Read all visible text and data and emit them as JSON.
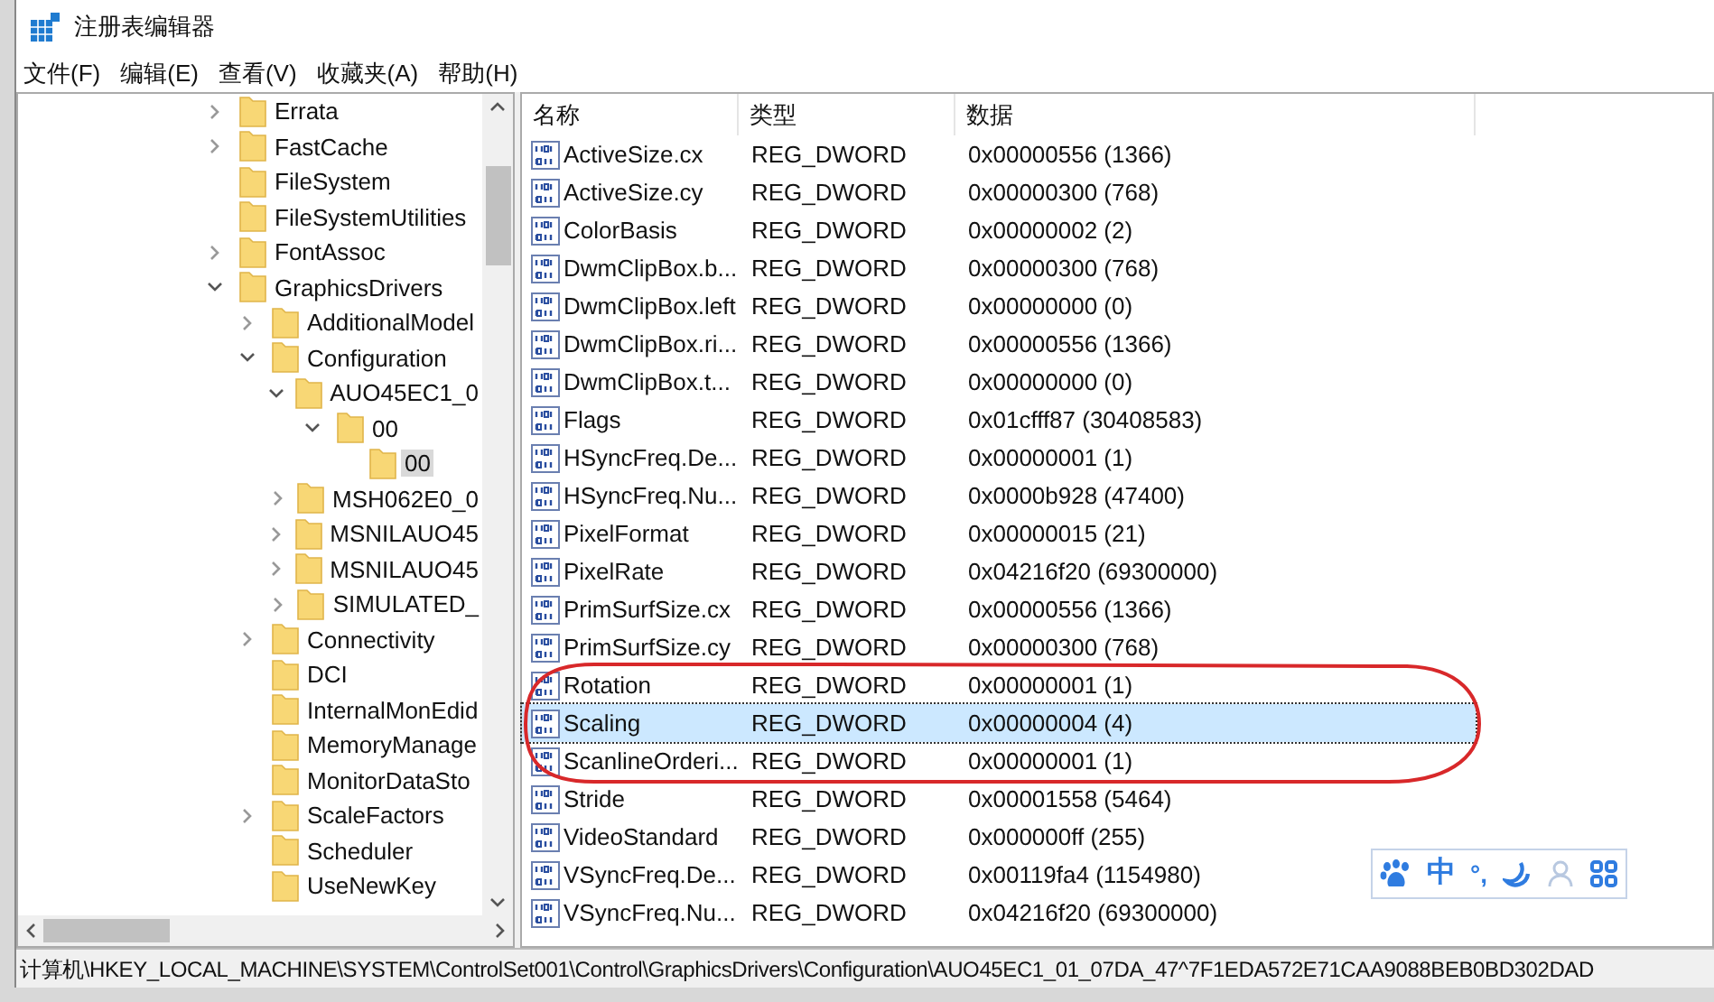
{
  "window": {
    "title": "注册表编辑器"
  },
  "menu": [
    "文件(F)",
    "编辑(E)",
    "查看(V)",
    "收藏夹(A)",
    "帮助(H)"
  ],
  "tree": [
    {
      "label": "Errata",
      "expanded": false,
      "selected": false
    },
    {
      "label": "FastCache",
      "expanded": false,
      "selected": false
    },
    {
      "label": "FileSystem",
      "selected": false
    },
    {
      "label": "FileSystemUtilities",
      "selected": false
    },
    {
      "label": "FontAssoc",
      "expanded": false,
      "selected": false
    },
    {
      "label": "GraphicsDrivers",
      "expanded": true,
      "selected": false,
      "children": [
        {
          "label": "AdditionalModel",
          "expanded": false,
          "selected": false
        },
        {
          "label": "Configuration",
          "expanded": true,
          "selected": false,
          "children": [
            {
              "label": "AUO45EC1_0",
              "expanded": true,
              "selected": false,
              "children": [
                {
                  "label": "00",
                  "expanded": true,
                  "selected": false,
                  "children": [
                    {
                      "label": "00",
                      "selected": true
                    }
                  ]
                }
              ]
            },
            {
              "label": "MSH062E0_0",
              "expanded": false,
              "selected": false
            },
            {
              "label": "MSNILAUO45",
              "expanded": false,
              "selected": false
            },
            {
              "label": "MSNILAUO45",
              "expanded": false,
              "selected": false
            },
            {
              "label": "SIMULATED_",
              "expanded": false,
              "selected": false
            }
          ]
        },
        {
          "label": "Connectivity",
          "expanded": false,
          "selected": false
        },
        {
          "label": "DCI",
          "selected": false
        },
        {
          "label": "InternalMonEdid",
          "selected": false
        },
        {
          "label": "MemoryManage",
          "selected": false
        },
        {
          "label": "MonitorDataSto",
          "selected": false
        },
        {
          "label": "ScaleFactors",
          "expanded": false,
          "selected": false
        },
        {
          "label": "Scheduler",
          "selected": false
        },
        {
          "label": "UseNewKey",
          "selected": false
        }
      ]
    }
  ],
  "table": {
    "columns": [
      "名称",
      "类型",
      "数据"
    ],
    "rows": [
      {
        "name": "ActiveSize.cx",
        "type": "REG_DWORD",
        "data": "0x00000556 (1366)",
        "selected": false
      },
      {
        "name": "ActiveSize.cy",
        "type": "REG_DWORD",
        "data": "0x00000300 (768)",
        "selected": false
      },
      {
        "name": "ColorBasis",
        "type": "REG_DWORD",
        "data": "0x00000002 (2)",
        "selected": false
      },
      {
        "name": "DwmClipBox.b...",
        "type": "REG_DWORD",
        "data": "0x00000300 (768)",
        "selected": false
      },
      {
        "name": "DwmClipBox.left",
        "type": "REG_DWORD",
        "data": "0x00000000 (0)",
        "selected": false
      },
      {
        "name": "DwmClipBox.ri...",
        "type": "REG_DWORD",
        "data": "0x00000556 (1366)",
        "selected": false
      },
      {
        "name": "DwmClipBox.t...",
        "type": "REG_DWORD",
        "data": "0x00000000 (0)",
        "selected": false
      },
      {
        "name": "Flags",
        "type": "REG_DWORD",
        "data": "0x01cfff87 (30408583)",
        "selected": false
      },
      {
        "name": "HSyncFreq.De...",
        "type": "REG_DWORD",
        "data": "0x00000001 (1)",
        "selected": false
      },
      {
        "name": "HSyncFreq.Nu...",
        "type": "REG_DWORD",
        "data": "0x0000b928 (47400)",
        "selected": false
      },
      {
        "name": "PixelFormat",
        "type": "REG_DWORD",
        "data": "0x00000015 (21)",
        "selected": false
      },
      {
        "name": "PixelRate",
        "type": "REG_DWORD",
        "data": "0x04216f20 (69300000)",
        "selected": false
      },
      {
        "name": "PrimSurfSize.cx",
        "type": "REG_DWORD",
        "data": "0x00000556 (1366)",
        "selected": false
      },
      {
        "name": "PrimSurfSize.cy",
        "type": "REG_DWORD",
        "data": "0x00000300 (768)",
        "selected": false
      },
      {
        "name": "Rotation",
        "type": "REG_DWORD",
        "data": "0x00000001 (1)",
        "selected": false
      },
      {
        "name": "Scaling",
        "type": "REG_DWORD",
        "data": "0x00000004 (4)",
        "selected": true
      },
      {
        "name": "ScanlineOrderi...",
        "type": "REG_DWORD",
        "data": "0x00000001 (1)",
        "selected": false
      },
      {
        "name": "Stride",
        "type": "REG_DWORD",
        "data": "0x00001558 (5464)",
        "selected": false
      },
      {
        "name": "VideoStandard",
        "type": "REG_DWORD",
        "data": "0x000000ff (255)",
        "selected": false
      },
      {
        "name": "VSyncFreq.De...",
        "type": "REG_DWORD",
        "data": "0x00119fa4 (1154980)",
        "selected": false
      },
      {
        "name": "VSyncFreq.Nu...",
        "type": "REG_DWORD",
        "data": "0x04216f20 (69300000)",
        "selected": false
      }
    ]
  },
  "ime_toolbar": {
    "mode": "中",
    "punctuation": "°,"
  },
  "status_bar": "计算机\\HKEY_LOCAL_MACHINE\\SYSTEM\\ControlSet001\\Control\\GraphicsDrivers\\Configuration\\AUO45EC1_01_07DA_47^7F1EDA572E71CAA9088BEB0BD302DAD"
}
